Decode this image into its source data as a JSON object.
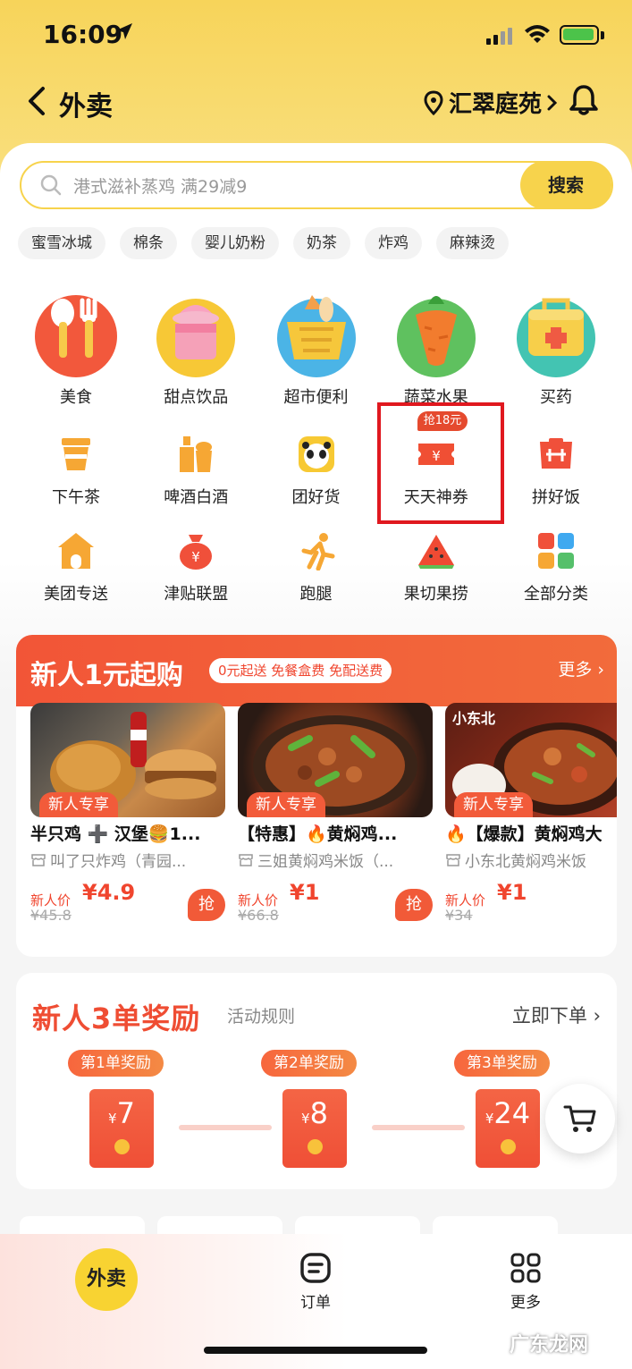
{
  "status_bar": {
    "time": "16:09"
  },
  "header": {
    "back_label": "外卖",
    "location": "汇翠庭苑"
  },
  "search": {
    "placeholder": "港式滋补蒸鸡 满29减9",
    "button_label": "搜索"
  },
  "hot_tags": [
    "蜜雪冰城",
    "棉条",
    "婴儿奶粉",
    "奶茶",
    "炸鸡",
    "麻辣烫"
  ],
  "main_categories": [
    {
      "label": "美食",
      "icon": "spoon-fork-icon"
    },
    {
      "label": "甜点饮品",
      "icon": "ice-cream-icon"
    },
    {
      "label": "超市便利",
      "icon": "shopping-basket-icon"
    },
    {
      "label": "蔬菜水果",
      "icon": "carrot-icon"
    },
    {
      "label": "买药",
      "icon": "medicine-box-icon"
    }
  ],
  "sub_categories": [
    {
      "label": "下午茶",
      "icon": "tea-cup-icon"
    },
    {
      "label": "啤酒白酒",
      "icon": "beer-bottle-icon"
    },
    {
      "label": "团好货",
      "icon": "panda-icon"
    },
    {
      "label": "天天神券",
      "icon": "coupon-icon",
      "badge": "抢18元"
    },
    {
      "label": "拼好饭",
      "icon": "pin-bag-icon"
    },
    {
      "label": "美团专送",
      "icon": "delivery-house-icon"
    },
    {
      "label": "津贴联盟",
      "icon": "money-bag-icon"
    },
    {
      "label": "跑腿",
      "icon": "runner-icon"
    },
    {
      "label": "果切果捞",
      "icon": "watermelon-icon"
    },
    {
      "label": "全部分类",
      "icon": "grid-icon"
    }
  ],
  "newbie": {
    "title": "新人1元起购",
    "subtitle": "0元起送 免餐盒费 免配送费",
    "more_label": "更多",
    "badge_label": "新人专享",
    "price_label": "新人价",
    "grab_label": "抢",
    "items": [
      {
        "name": "半只鸡 ➕ 汉堡🍔1...",
        "shop": "叫了只炸鸡（青园...",
        "price": "¥4.9",
        "orig_price": "¥45.8"
      },
      {
        "name": "【特惠】🔥黄焖鸡...",
        "shop": "三姐黄焖鸡米饭（...",
        "price": "¥1",
        "orig_price": "¥66.8"
      },
      {
        "name": "🔥【爆款】黄焖鸡大",
        "shop": "小东北黄焖鸡米饭",
        "price": "¥1",
        "orig_price": "¥34",
        "img_text": "小东北"
      }
    ]
  },
  "rewards": {
    "title": "新人3单奖励",
    "rules_label": "活动规则",
    "order_now_label": "立即下单",
    "currency": "¥",
    "items": [
      {
        "badge": "第1单奖励",
        "amount": "7"
      },
      {
        "badge": "第2单奖励",
        "amount": "8"
      },
      {
        "badge": "第3单奖励",
        "amount": "24"
      }
    ]
  },
  "tabbar": {
    "home_label": "外卖",
    "orders_label": "订单",
    "more_label": "更多"
  },
  "watermark": "广东龙网",
  "colors": {
    "brand_yellow": "#f7d34c",
    "accent_red": "#f0452e",
    "highlight_box": "#e0181f"
  }
}
